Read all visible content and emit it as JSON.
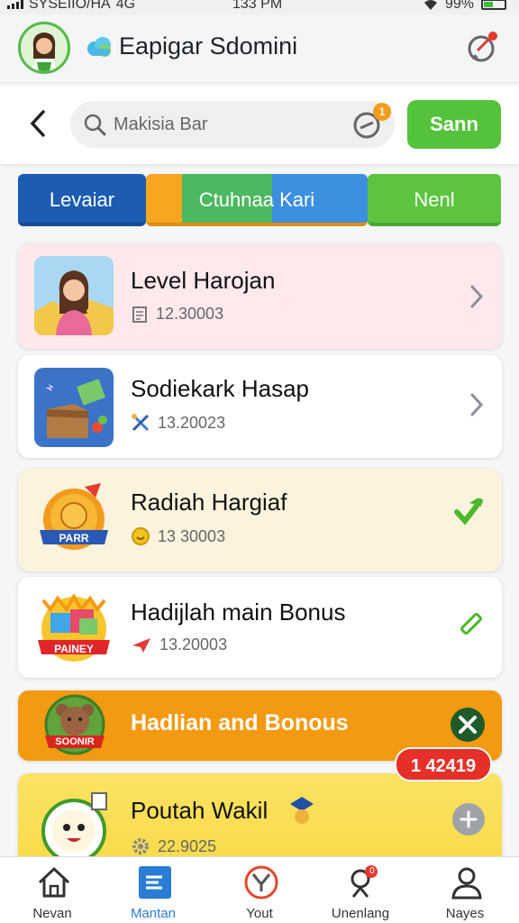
{
  "status_bar": {
    "carrier": "SYSEIIO/HA",
    "network": "4G",
    "time": "133 PM",
    "battery": "99%"
  },
  "app": {
    "title": "Eapigar Sdomini"
  },
  "search": {
    "placeholder": "Makisia Bar",
    "filter_badge": "1",
    "scan_label": "Sann"
  },
  "tabs": [
    {
      "label": "Levaiar",
      "color": "#1c5cb2"
    },
    {
      "label": "Ctuhnaa Kari",
      "color": "#4cb860"
    },
    {
      "label": "Nenl",
      "color": "#5cc43e"
    }
  ],
  "items": [
    {
      "title": "Level Harojan",
      "meta": "12.30003",
      "meta_icon": "document-icon",
      "action_icon": "chevron-right-icon"
    },
    {
      "title": "Sodiekark Hasap",
      "meta": "13.20023",
      "meta_icon": "tools-icon",
      "action_icon": "chevron-right-icon"
    },
    {
      "title": "Radiah Hargiaf",
      "meta": "13 30003",
      "meta_icon": "coin-icon",
      "action_icon": "check-badge-icon",
      "thumb_label": "PARR"
    },
    {
      "title": "Hadijlah main Bonus",
      "meta": "13.20003",
      "meta_icon": "airplane-icon",
      "action_icon": "pencil-icon",
      "thumb_label": "PAINEY"
    },
    {
      "title": "Hadlian and Bonous",
      "action_icon": "close-icon",
      "thumb_label": "SOONIR"
    },
    {
      "title": "Poutah Wakil",
      "meta": "22.9025",
      "meta_icon": "gear-icon",
      "action_icon": "plus-icon"
    }
  ],
  "points_badge": "1 42419",
  "bottom_nav": [
    {
      "label": "Nevan",
      "icon": "home-icon"
    },
    {
      "label": "Mantan",
      "icon": "list-icon",
      "active": true
    },
    {
      "label": "Yout",
      "icon": "target-icon"
    },
    {
      "label": "Unenlang",
      "icon": "user-notification-icon",
      "badge": "0"
    },
    {
      "label": "Nayes",
      "icon": "profile-icon"
    }
  ],
  "colors": {
    "accent_green": "#55c23c",
    "accent_blue": "#1c5cb2",
    "badge_red": "#e53029",
    "orange": "#f39a12"
  }
}
